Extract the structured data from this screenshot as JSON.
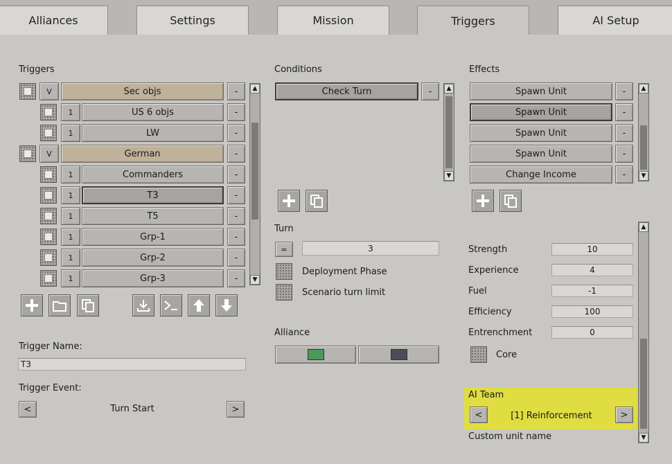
{
  "tabs": [
    "Alliances",
    "Settings",
    "Mission",
    "Triggers",
    "AI Setup"
  ],
  "triggers": {
    "label": "Triggers",
    "rows": [
      {
        "prefix": "V",
        "name": "Sec objs",
        "gold": true
      },
      {
        "prefix": "1",
        "name": "US 6 objs"
      },
      {
        "prefix": "1",
        "name": "LW"
      },
      {
        "prefix": "V",
        "name": "German",
        "gold": true
      },
      {
        "prefix": "1",
        "name": "Commanders"
      },
      {
        "prefix": "1",
        "name": "T3",
        "selected": true
      },
      {
        "prefix": "1",
        "name": "T5"
      },
      {
        "prefix": "1",
        "name": "Grp-1"
      },
      {
        "prefix": "1",
        "name": "Grp-2"
      },
      {
        "prefix": "1",
        "name": "Grp-3"
      }
    ],
    "minus": "-",
    "trigger_name_label": "Trigger Name:",
    "trigger_name_value": "T3",
    "trigger_event_label": "Trigger Event:",
    "trigger_event_value": "Turn Start",
    "prev": "<",
    "next": ">"
  },
  "conditions": {
    "label": "Conditions",
    "items": [
      "Check Turn"
    ],
    "minus": "-",
    "turn_label": "Turn",
    "turn_op": "=",
    "turn_value": "3",
    "deployment_phase": "Deployment Phase",
    "scenario_turn_limit": "Scenario turn limit",
    "alliance_label": "Alliance",
    "alliance_colors": [
      "#4a9a5c",
      "#4a4e57"
    ]
  },
  "effects": {
    "label": "Effects",
    "items": [
      "Spawn Unit",
      "Spawn Unit",
      "Spawn Unit",
      "Spawn Unit",
      "Change Income"
    ],
    "minus": "-",
    "stats": [
      {
        "label": "Strength",
        "value": "10"
      },
      {
        "label": "Experience",
        "value": "4"
      },
      {
        "label": "Fuel",
        "value": "-1"
      },
      {
        "label": "Efficiency",
        "value": "100"
      },
      {
        "label": "Entrenchment",
        "value": "0"
      }
    ],
    "core_label": "Core",
    "ai_team_label": "AI Team",
    "ai_team_value": "[1] Reinforcement",
    "prev": "<",
    "next": ">",
    "custom_unit_name": "Custom unit name"
  },
  "colors": {
    "highlight": "#e3e12a",
    "gold_row": "#bfb19a"
  }
}
